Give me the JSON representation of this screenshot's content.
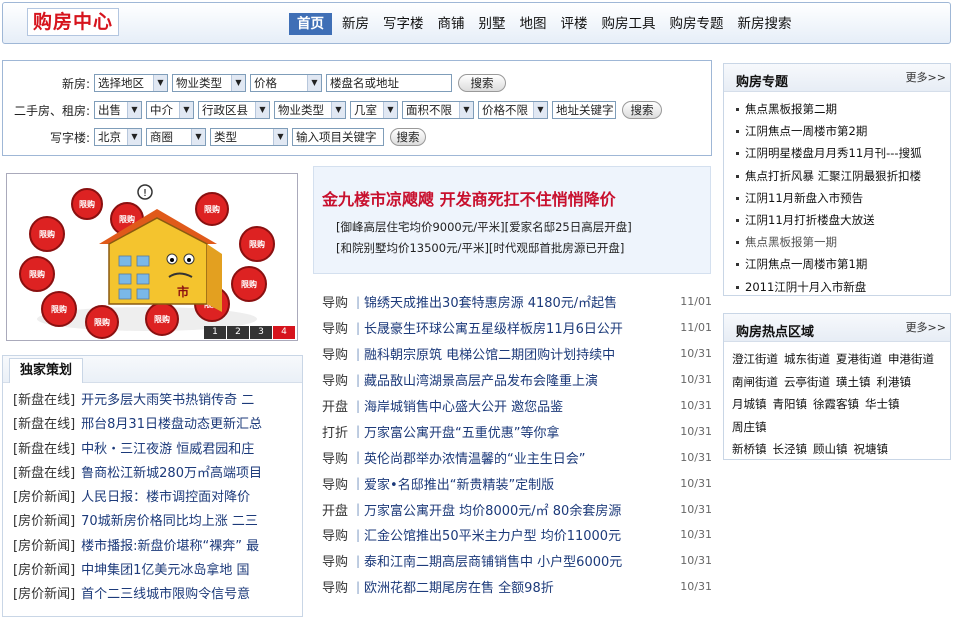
{
  "header": {
    "logo": "购房中心",
    "nav": [
      "首页",
      "新房",
      "写字楼",
      "商铺",
      "别墅",
      "地图",
      "评楼",
      "购房工具",
      "购房专题",
      "新房搜索"
    ]
  },
  "search": {
    "row1": {
      "label": "新房:",
      "selects": [
        "选择地区",
        "物业类型",
        "价格"
      ],
      "input": "楼盘名或地址",
      "button": "搜索"
    },
    "row2": {
      "label": "二手房、租房:",
      "selects": [
        "出售",
        "中介",
        "行政区县",
        "物业类型",
        "几室",
        "面积不限",
        "价格不限"
      ],
      "input": "地址关键字",
      "button": "搜索"
    },
    "row3": {
      "label": "写字楼:",
      "selects": [
        "北京",
        "商圈",
        "类型"
      ],
      "input": "输入项目关键字",
      "button": "搜索"
    }
  },
  "banner": {
    "pager": [
      "1",
      "2",
      "3",
      "4"
    ],
    "active_page": 4,
    "sign_text": "限购",
    "house_text": "市"
  },
  "headline": {
    "title": "金九楼市凉飕飕 开发商死扛不住悄悄降价",
    "sub1": "[御峰高层住宅均价9000元/平米][爱家名邸25日高层开盘]",
    "sub2": "[和院别墅均价13500元/平米][时代观邸首批房源已开盘]"
  },
  "news": [
    {
      "cat": "导购",
      "title": "锦绣天成推出30套特惠房源 4180元/㎡起售",
      "date": "11/01"
    },
    {
      "cat": "导购",
      "title": "长晟豪生环球公寓五星级样板房11月6日公开",
      "date": "11/01"
    },
    {
      "cat": "导购",
      "title": "融科朝宗原筑 电梯公馆二期团购计划持续中",
      "date": "10/31"
    },
    {
      "cat": "导购",
      "title": "藏品敔山湾湖景高层产品发布会隆重上演",
      "date": "10/31"
    },
    {
      "cat": "开盘",
      "title": "海岸城销售中心盛大公开 邀您品鉴",
      "date": "10/31"
    },
    {
      "cat": "打折",
      "title": "万家富公寓开盘“五重优惠”等你拿",
      "date": "10/31"
    },
    {
      "cat": "导购",
      "title": "英伦尚郡举办浓情温馨的“业主生日会”",
      "date": "10/31"
    },
    {
      "cat": "导购",
      "title": "爱家•名邸推出“新贵精装”定制版",
      "date": "10/31"
    },
    {
      "cat": "开盘",
      "title": "万家富公寓开盘 均价8000元/㎡ 80余套房源",
      "date": "10/31"
    },
    {
      "cat": "导购",
      "title": "汇金公馆推出50平米主力户型 均价11000元",
      "date": "10/31"
    },
    {
      "cat": "导购",
      "title": "泰和江南二期高层商铺销售中 小户型6000元",
      "date": "10/31"
    },
    {
      "cat": "导购",
      "title": "欧洲花都二期尾房在售 全额98折",
      "date": "10/31"
    }
  ],
  "exclusive": {
    "title": "独家策划",
    "items": [
      {
        "cat": "[新盘在线]",
        "title": "开元多层大雨笑书热销传奇 二"
      },
      {
        "cat": "[新盘在线]",
        "title": "邢台8月31日楼盘动态更新汇总"
      },
      {
        "cat": "[新盘在线]",
        "title": "中秋・三江夜游 恒威君园和庄"
      },
      {
        "cat": "[新盘在线]",
        "title": "鲁商松江新城280万㎡高端项目"
      },
      {
        "cat": "[房价新闻]",
        "title": "人民日报：楼市调控面对降价"
      },
      {
        "cat": "[房价新闻]",
        "title": "70城新房价格同比均上涨 二三"
      },
      {
        "cat": "[房价新闻]",
        "title": "楼市播报:新盘价堪称“裸奔” 最"
      },
      {
        "cat": "[房价新闻]",
        "title": "中坤集团1亿美元冰岛拿地 国"
      },
      {
        "cat": "[房价新闻]",
        "title": "首个二三线城市限购令信号意"
      }
    ]
  },
  "topics": {
    "title": "购房专题",
    "more": "更多>>",
    "items": [
      {
        "text": "焦点黑板报第二期",
        "gray": false
      },
      {
        "text": "江阴焦点一周楼市第2期",
        "gray": false
      },
      {
        "text": "江阴明星楼盘月月秀11月刊---搜狐",
        "gray": false
      },
      {
        "text": "焦点打折风暴 汇聚江阴最狠折扣楼",
        "gray": false
      },
      {
        "text": "江阴11月新盘入市预告",
        "gray": false
      },
      {
        "text": "江阴11月打折楼盘大放送",
        "gray": false
      },
      {
        "text": "焦点黑板报第一期",
        "gray": true
      },
      {
        "text": "江阴焦点一周楼市第1期",
        "gray": false
      },
      {
        "text": "2011江阴十月入市新盘",
        "gray": false
      }
    ]
  },
  "areas": {
    "title": "购房热点区域",
    "more": "更多>>",
    "items": [
      "澄江街道",
      "城东街道",
      "夏港街道",
      "申港街道",
      "南闸街道",
      "云亭街道",
      "璜土镇",
      "利港镇",
      "月城镇",
      "青阳镇",
      "徐霞客镇",
      "华士镇",
      "周庄镇",
      "新桥镇",
      "长泾镇",
      "顾山镇",
      "祝塘镇"
    ]
  }
}
